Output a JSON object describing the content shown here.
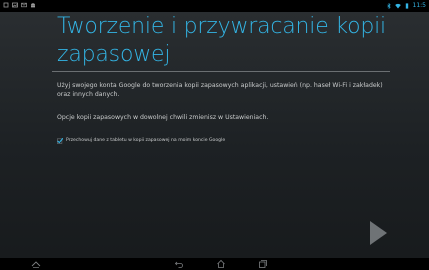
{
  "statusbar": {
    "left_icons": [
      "usb-icon",
      "image-icon",
      "mail-icon",
      "android-icon"
    ],
    "time": "11:5"
  },
  "setup": {
    "title": "Tworzenie i przywracanie kopii zapasowej",
    "paragraph1": "Użyj swojego konta Google do tworzenia kopii zapasowych aplikacji, ustawień (np. haseł Wi-Fi i zakładek) oraz innych danych.",
    "paragraph2": "Opcje kopii zapasowych w dowolnej chwili zmienisz w Ustawieniach.",
    "checkbox_label": "Przechowuj dane z tabletu w kopii zapasowej na moim koncie Google",
    "checkbox_checked": true
  },
  "navbar": {
    "icons": [
      "asus-home-icon",
      "back-icon",
      "home-icon",
      "recent-apps-icon"
    ]
  },
  "colors": {
    "accent": "#33b5e5",
    "background": "#222629",
    "text": "#c9cbcc"
  }
}
